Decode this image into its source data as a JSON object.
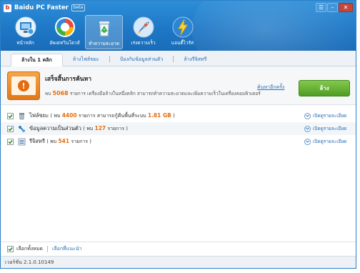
{
  "app": {
    "title": "Baidu PC Faster",
    "badge": "beta"
  },
  "window_controls": {
    "menu": "☰",
    "minimize": "–",
    "close": "✕"
  },
  "nav": [
    {
      "label": "หน้าหลัก",
      "icon": "home-monitor-icon"
    },
    {
      "label": "อัพเดทวินโดวส์",
      "icon": "update-icon"
    },
    {
      "label": "ทำความสะอาด",
      "icon": "recycle-bin-icon"
    },
    {
      "label": "เร่งความเร็ว",
      "icon": "rocket-icon"
    },
    {
      "label": "แอนตี้ไวรัส",
      "icon": "lightning-shield-icon"
    }
  ],
  "tabs": [
    {
      "label": "ล้างใน 1 คลิก",
      "active": true
    },
    {
      "label": "ล้างไฟล์ขยะ",
      "active": false
    },
    {
      "label": "ป้องกันข้อมูลส่วนตัว",
      "active": false
    },
    {
      "label": "ล้างรีจิสทรี",
      "active": false
    }
  ],
  "summary": {
    "title": "เสร็จสิ้นการค้นหา",
    "prefix": "พบ ",
    "count": "5068",
    "suffix": " รายการ เครื่องมือล้างในหนึ่งคลิก สามารถทำความสะอาดและเพิ่มความเร็วในเครื่องคอมพิวเตอร์",
    "rescan": "ค้นหาอีกครั้ง",
    "clean_button": "ล้าง"
  },
  "items": [
    {
      "name": "ไฟล์ขยะ",
      "pre": " ( พบ ",
      "count": "4400",
      "mid": " รายการ สามารถกู้คืนพื้นที่ระบบ ",
      "size": "1.81 GB",
      "post": " )",
      "details": "เปิดดูรายละเอียด",
      "icon": "trash-icon"
    },
    {
      "name": "ข้อมูลความเป็นส่วนตัว",
      "pre": " ( พบ ",
      "count": "127",
      "mid": " รายการ )",
      "size": "",
      "post": "",
      "details": "เปิดดูรายละเอียด",
      "icon": "privacy-icon"
    },
    {
      "name": "รีจิสทรี",
      "pre": " ( พบ ",
      "count": "541",
      "mid": " รายการ )",
      "size": "",
      "post": "",
      "details": "เปิดดูรายละเอียด",
      "icon": "registry-icon"
    }
  ],
  "footer": {
    "select_all": "เลือกทั้งหมด",
    "recommended": "เลือกที่แนะนำ"
  },
  "status": {
    "version": "เวอร์ชั่น 2.1.0.10149"
  },
  "colors": {
    "header_blue": "#1e78c6",
    "accent_orange": "#e56e10",
    "clean_green": "#5aa82a",
    "link_blue": "#2a6fb7"
  }
}
